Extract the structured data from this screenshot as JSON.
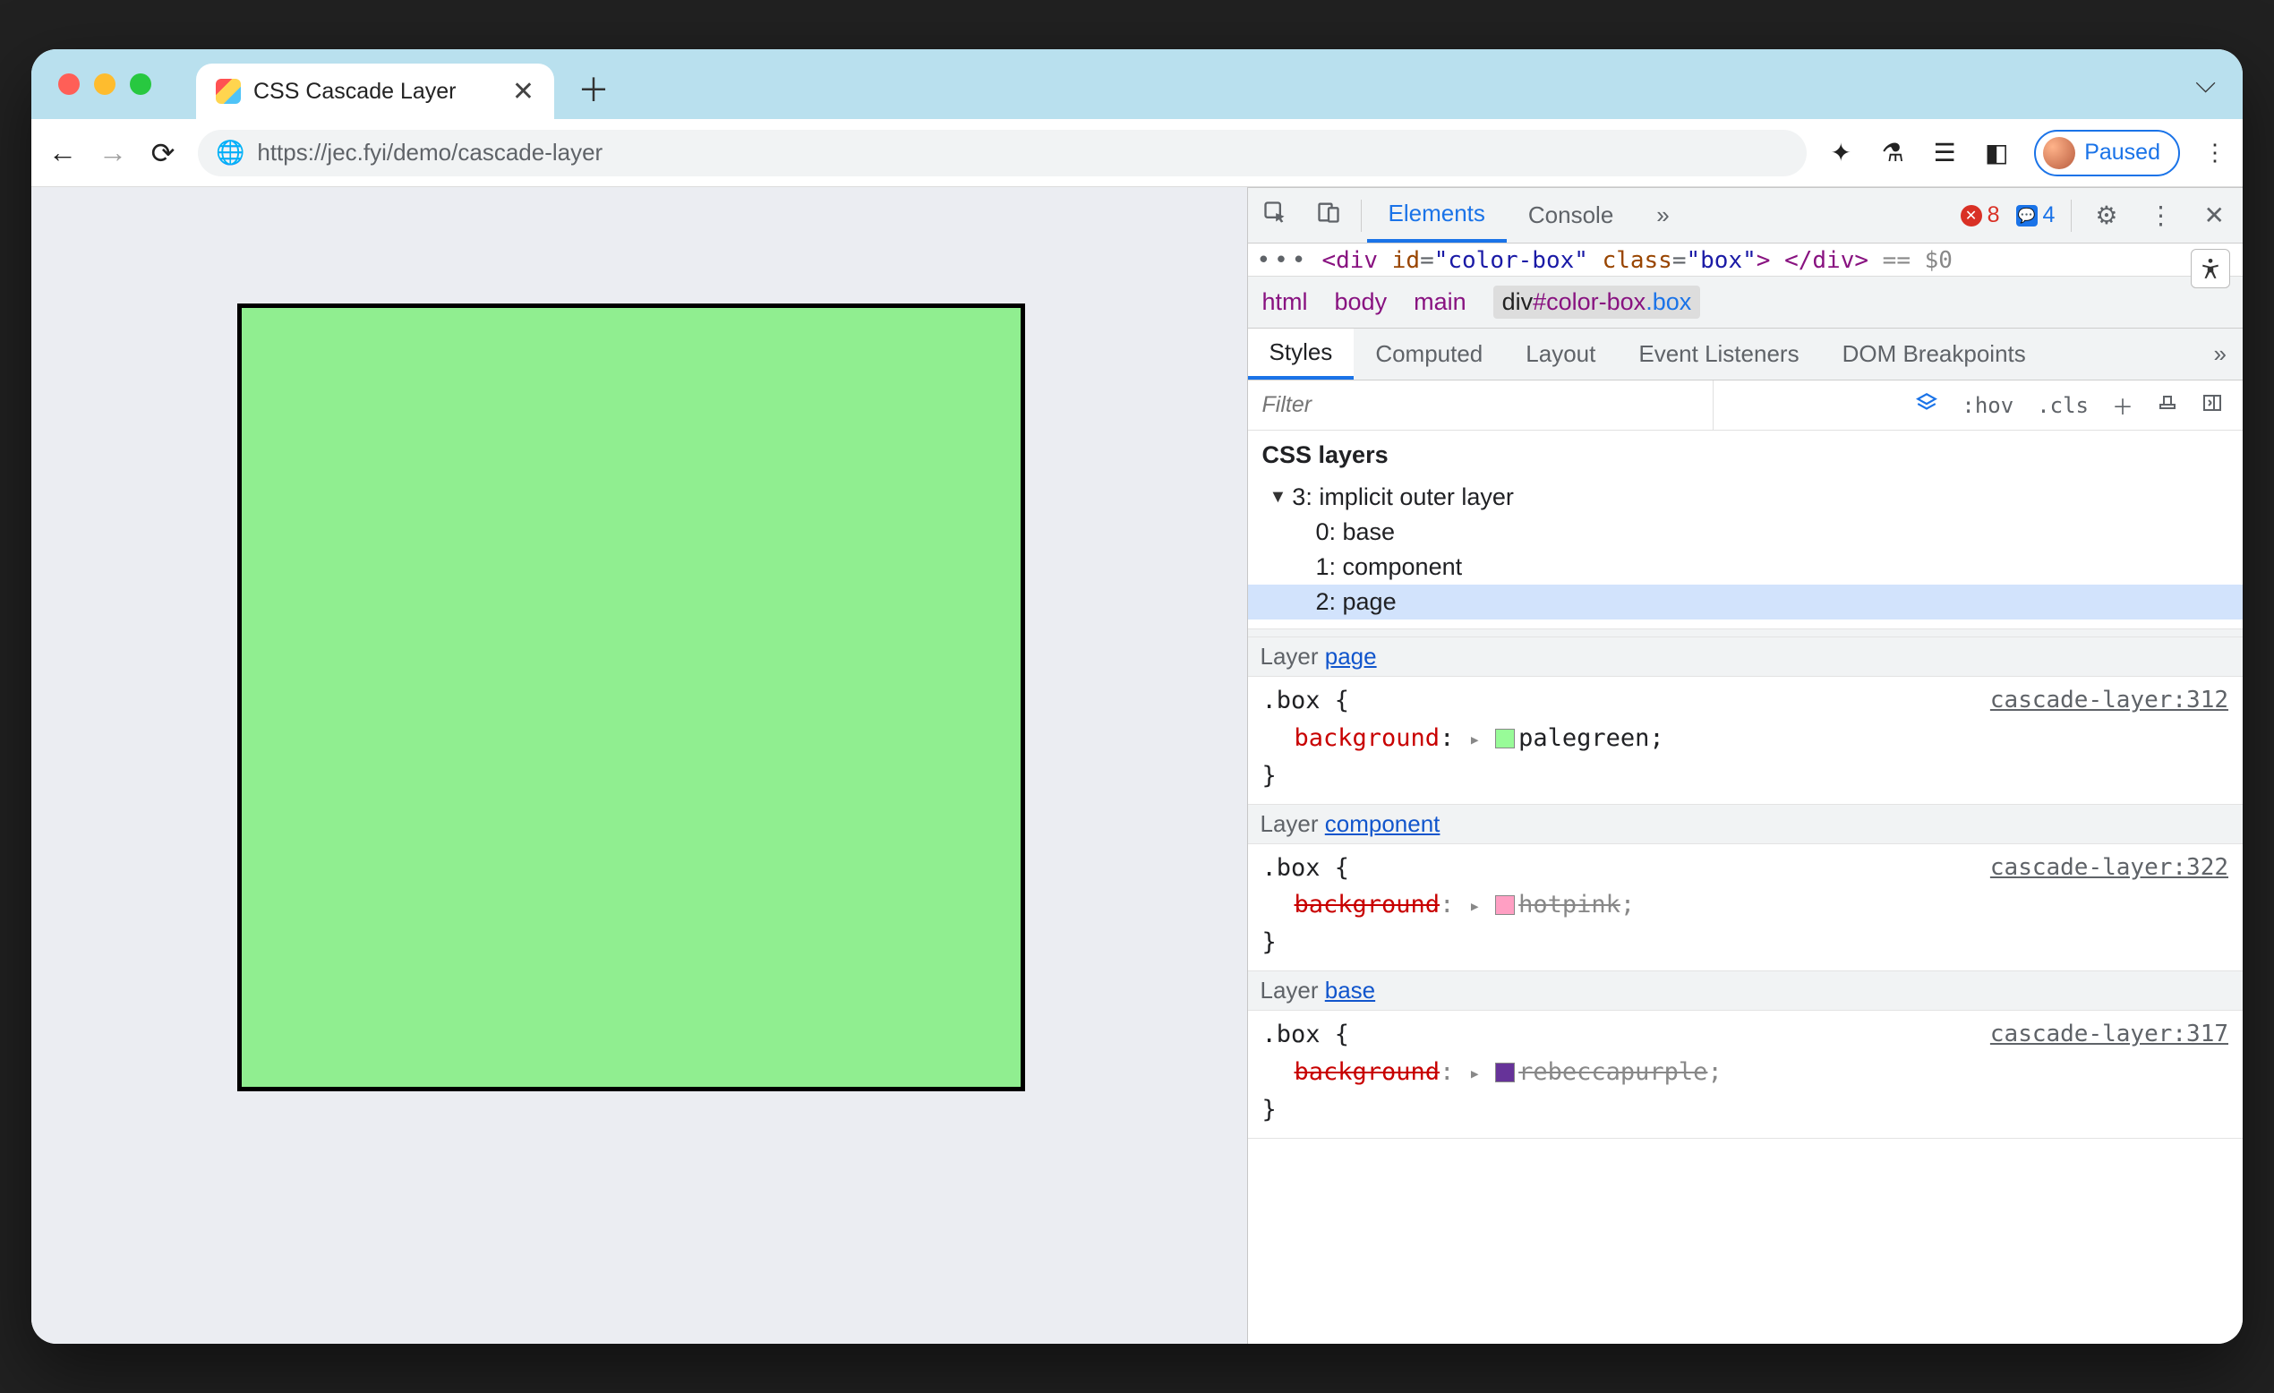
{
  "tab": {
    "title": "CSS Cascade Layer"
  },
  "url": {
    "text": "https://jec.fyi/demo/cascade-layer"
  },
  "paused_chip": "Paused",
  "devtools": {
    "tabs": [
      "Elements",
      "Console"
    ],
    "active_tab": "Elements",
    "more": "»",
    "errors": "8",
    "messages": "4",
    "source_line": {
      "open": "<div",
      "id_attr": "id",
      "id_val": "\"color-box\"",
      "class_attr": "class",
      "class_val": "\"box\"",
      "close": "</div>",
      "tail": "== $0"
    },
    "breadcrumb": {
      "items": [
        "html",
        "body",
        "main"
      ],
      "selected": "div#color-box.box"
    },
    "styles_tabs": [
      "Styles",
      "Computed",
      "Layout",
      "Event Listeners",
      "DOM Breakpoints"
    ],
    "styles_more": "»",
    "filter_placeholder": "Filter",
    "filter_tools": {
      "hov": ":hov",
      "cls": ".cls"
    },
    "css_layers_heading": "CSS layers",
    "layer_tree": {
      "root": "3: implicit outer layer",
      "children": [
        "0: base",
        "1: component",
        "2: page"
      ],
      "selected_index": 2
    },
    "rules": [
      {
        "layer_label_prefix": "Layer ",
        "layer_link": "page",
        "selector": ".box",
        "source": "cascade-layer:312",
        "prop_key": "background",
        "prop_value": "palegreen",
        "swatch": "#98fb98",
        "overridden": false
      },
      {
        "layer_label_prefix": "Layer ",
        "layer_link": "component",
        "selector": ".box",
        "source": "cascade-layer:322",
        "prop_key": "background",
        "prop_value": "hotpink",
        "swatch": "#ff9fc3",
        "overridden": true
      },
      {
        "layer_label_prefix": "Layer ",
        "layer_link": "base",
        "selector": ".box",
        "source": "cascade-layer:317",
        "prop_key": "background",
        "prop_value": "rebeccapurple",
        "swatch": "#663399",
        "overridden": true
      }
    ]
  }
}
